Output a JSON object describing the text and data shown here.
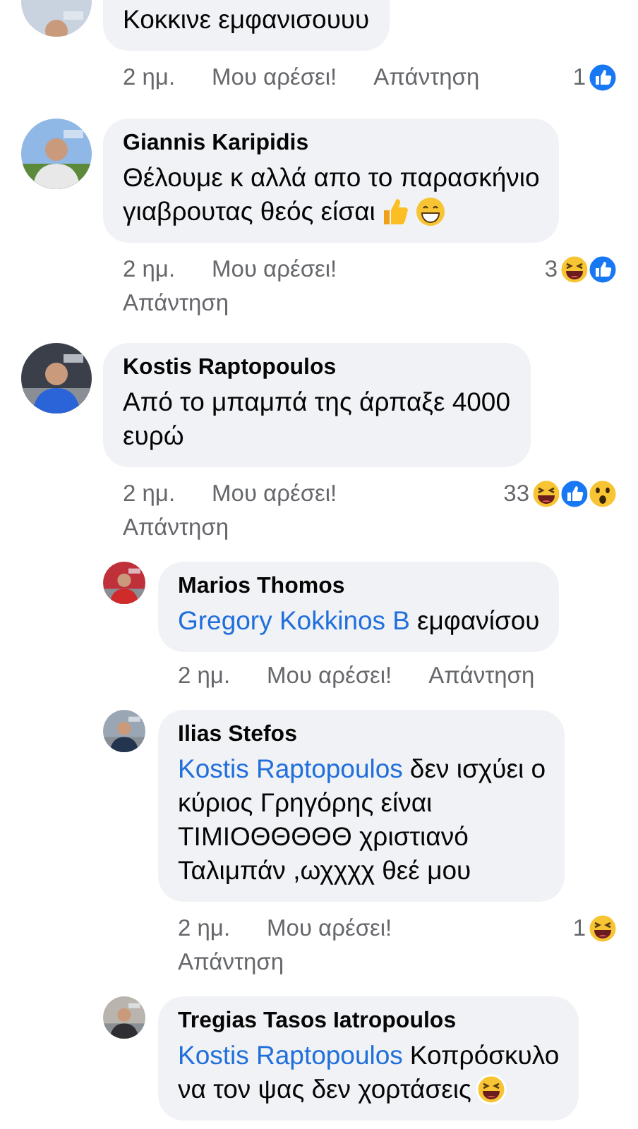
{
  "comments": [
    {
      "kind": "comment",
      "text_lines": [
        "Κοκκινε εμφανισουυυ"
      ],
      "time": "2 ημ.",
      "like": "Μου αρέσει!",
      "reply": "Απάντηση",
      "reply_below": false,
      "count": "1",
      "reactions": [
        {
          "kind": "like"
        }
      ],
      "avatar_cut": true
    },
    {
      "kind": "comment",
      "author": "Giannis Karipidis",
      "text_lines": [
        "Θέλουμε κ αλλά απο το παρασκήνιο",
        "γιαβρουτας θεός είσαι"
      ],
      "emojis": [
        {
          "kind": "thumbs-up"
        },
        {
          "kind": "grin"
        }
      ],
      "time": "2 ημ.",
      "like": "Μου αρέσει!",
      "reply": "Απάντηση",
      "reply_below": true,
      "count": "3",
      "reactions": [
        {
          "kind": "haha"
        },
        {
          "kind": "like"
        }
      ],
      "avatar_cut": false
    },
    {
      "kind": "comment",
      "author": "Kostis Raptopoulos",
      "text_lines": [
        "Από το μπαμπά της άρπαξε 4000",
        "ευρώ"
      ],
      "time": "2 ημ.",
      "like": "Μου αρέσει!",
      "reply": "Απάντηση",
      "reply_below": true,
      "count": "33",
      "reactions": [
        {
          "kind": "haha"
        },
        {
          "kind": "like"
        },
        {
          "kind": "wow"
        }
      ],
      "avatar_cut": false
    },
    {
      "kind": "reply",
      "author": "Marios Thomos",
      "mention": "Gregory Kokkinos B",
      "text_lines": [
        "εμφανίσου"
      ],
      "time": "2 ημ.",
      "like": "Μου αρέσει!",
      "reply": "Απάντηση",
      "reply_below": false,
      "avatar_cut": false
    },
    {
      "kind": "reply",
      "author": "Ilias Stefos",
      "mention": "Kostis Raptopoulos",
      "text_lines": [
        "δεν ισχύει ο",
        "κύριος Γρηγόρης είναι",
        "ΤΙΜΙΟΘΘΘΘΘ χριστιανό",
        "Ταλιμπάν ,ωχχχχ θεέ μου"
      ],
      "time": "2 ημ.",
      "like": "Μου αρέσει!",
      "reply": "Απάντηση",
      "reply_below": true,
      "count": "1",
      "reactions": [
        {
          "kind": "haha"
        }
      ],
      "avatar_cut": false
    },
    {
      "kind": "reply",
      "author": "Tregias Tasos Iatropoulos",
      "mention": "Kostis Raptopoulos",
      "text_lines": [
        "Κοπρόσκυλο",
        "να τον ψας δεν χορτάσεις"
      ],
      "emojis": [
        {
          "kind": "tears-of-joy"
        }
      ],
      "avatar_cut": false
    }
  ]
}
